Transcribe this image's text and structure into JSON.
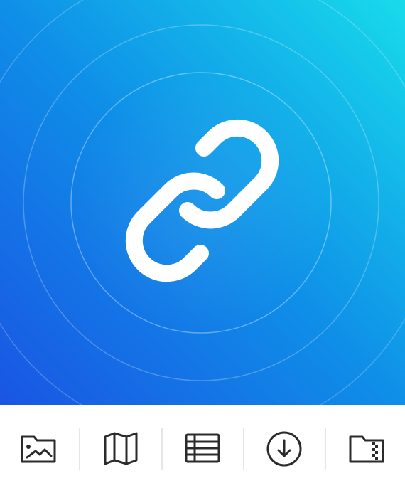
{
  "hero": {
    "icon": "link-icon",
    "gradient_colors": [
      "#1a5fe6",
      "#108fe9",
      "#16d6ec"
    ],
    "accent_color": "#ffffff"
  },
  "toolbar": {
    "icon_color": "#2b2b2b",
    "separator_color": "#e6e6e6",
    "tools": [
      {
        "icon": "image-folder-icon"
      },
      {
        "icon": "map-icon"
      },
      {
        "icon": "table-icon"
      },
      {
        "icon": "download-icon"
      },
      {
        "icon": "zip-folder-icon"
      }
    ]
  }
}
